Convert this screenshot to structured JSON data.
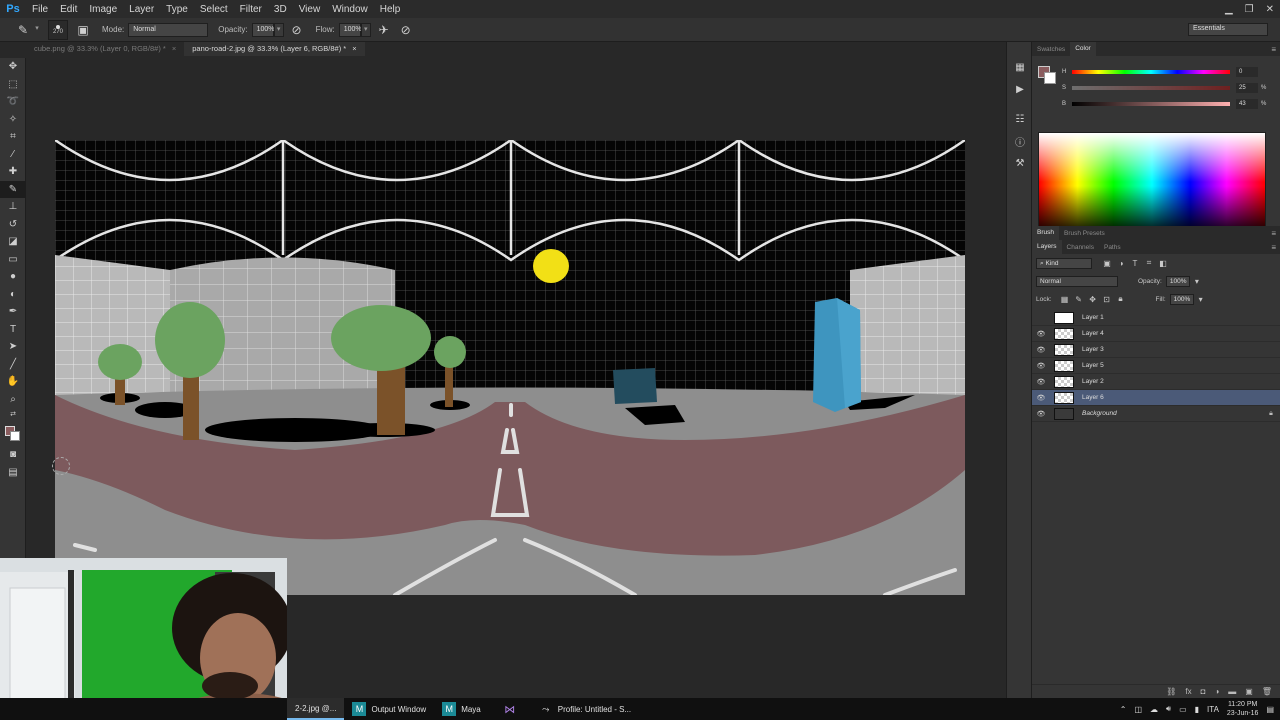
{
  "app": {
    "logo": "Ps",
    "menu": [
      "File",
      "Edit",
      "Image",
      "Layer",
      "Type",
      "Select",
      "Filter",
      "3D",
      "View",
      "Window",
      "Help"
    ],
    "window_controls": {
      "minimize": "▁",
      "restore": "❐",
      "close": "✕"
    }
  },
  "options_bar": {
    "brush_size": "270",
    "mode_label": "Mode:",
    "mode_value": "Normal",
    "opacity_label": "Opacity:",
    "opacity_value": "100%",
    "flow_label": "Flow:",
    "flow_value": "100%",
    "workspace": "Essentials"
  },
  "tabs": [
    {
      "label": "cube.png @ 33.3% (Layer 0, RGB/8#) *",
      "active": false
    },
    {
      "label": "pano-road-2.jpg @ 33.3% (Layer 6, RGB/8#) *",
      "active": true
    }
  ],
  "color_panel": {
    "tabs": [
      "Swatches",
      "Color"
    ],
    "active_tab": "Color",
    "foreground_color": "#8a5c5e",
    "background_color": "#ffffff",
    "h": {
      "label": "H",
      "value": "0",
      "unit": ""
    },
    "s": {
      "label": "S",
      "value": "25",
      "unit": "%"
    },
    "b": {
      "label": "B",
      "value": "43",
      "unit": "%"
    }
  },
  "brush_panel": {
    "tabs": [
      "Brush",
      "Brush Presets"
    ]
  },
  "layers_panel": {
    "tabs": [
      "Layers",
      "Channels",
      "Paths"
    ],
    "filter_kind": "Kind",
    "blend_mode": "Normal",
    "opacity_label": "Opacity:",
    "opacity_value": "100%",
    "lock_label": "Lock:",
    "fill_label": "Fill:",
    "fill_value": "100%",
    "layers": [
      {
        "name": "Layer 1",
        "visible": false,
        "selected": false,
        "thumb": "white",
        "locked": false
      },
      {
        "name": "Layer 4",
        "visible": true,
        "selected": false,
        "thumb": "checker",
        "locked": false
      },
      {
        "name": "Layer 3",
        "visible": true,
        "selected": false,
        "thumb": "checker",
        "locked": false
      },
      {
        "name": "Layer 5",
        "visible": true,
        "selected": false,
        "thumb": "checker",
        "locked": false
      },
      {
        "name": "Layer 2",
        "visible": true,
        "selected": false,
        "thumb": "checker",
        "locked": false
      },
      {
        "name": "Layer 6",
        "visible": true,
        "selected": true,
        "thumb": "checker",
        "locked": false
      },
      {
        "name": "Background",
        "visible": true,
        "selected": false,
        "thumb": "dark",
        "locked": true
      }
    ]
  },
  "taskbar": {
    "items": [
      {
        "label": "2-2.jpg @...",
        "icon": "photoshop-icon",
        "active": true
      },
      {
        "label": "Output Window",
        "icon": "maya-icon",
        "active": false
      },
      {
        "label": "Maya",
        "icon": "maya-icon",
        "active": false
      },
      {
        "label": "",
        "icon": "visual-studio-icon",
        "active": false
      },
      {
        "label": "Profile: Untitled - S...",
        "icon": "profiler-icon",
        "active": false
      }
    ],
    "language": "ITA",
    "time": "11:20 PM",
    "date": "23-Jun-16"
  },
  "colors": {
    "sky_sun": "#f2e016",
    "tree_green": "#6ba360",
    "tree_trunk": "#7b5229",
    "road_mauve": "#7d5a5d",
    "ground_gray": "#8e8e8e",
    "tower_blue": "#3e95bf",
    "box_teal": "#234c5e",
    "selection_blue": "#4b5a78"
  }
}
